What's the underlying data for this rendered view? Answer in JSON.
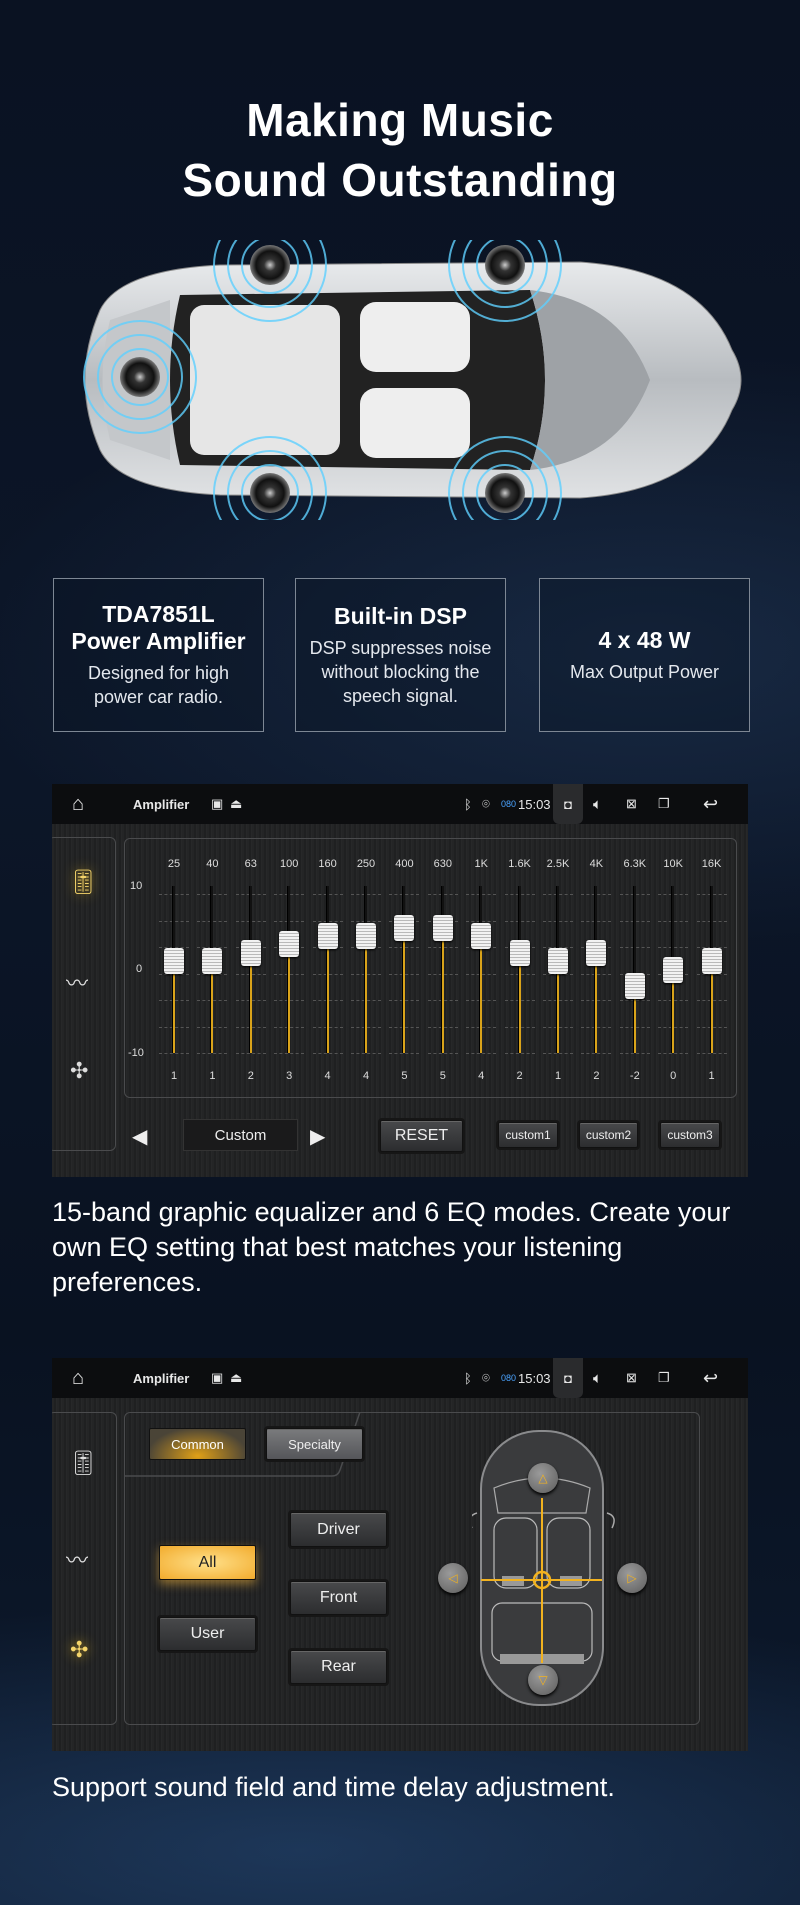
{
  "hero": {
    "title_line1": "Making Music",
    "title_line2": "Sound Outstanding"
  },
  "features": [
    {
      "heading": "TDA7851L Power Amplifier",
      "body": "Designed for high power car radio."
    },
    {
      "heading": "Built-in DSP",
      "body": "DSP suppresses noise without blocking the speech signal."
    },
    {
      "heading": "4 x 48 W",
      "body": "Max Output Power"
    }
  ],
  "status_bar": {
    "app_title": "Amplifier",
    "time": "15:03",
    "badge": "080",
    "icons": [
      "home-icon",
      "image-icon",
      "usb-icon",
      "bluetooth-icon",
      "location-icon",
      "camera-icon",
      "volume-icon",
      "close-box-icon",
      "windows-icon",
      "back-icon"
    ]
  },
  "equalizer": {
    "bands": [
      "25",
      "40",
      "63",
      "100",
      "160",
      "250",
      "400",
      "630",
      "1K",
      "1.6K",
      "2.5K",
      "4K",
      "6.3K",
      "10K",
      "16K"
    ],
    "values": [
      1,
      1,
      2,
      3,
      4,
      4,
      5,
      5,
      4,
      2,
      1,
      2,
      -2,
      0,
      1
    ],
    "range": [
      -10,
      10
    ],
    "axis_labels": [
      "10",
      "0",
      "-10"
    ],
    "preset": "Custom",
    "reset_label": "RESET",
    "custom_buttons": [
      "custom1",
      "custom2",
      "custom3"
    ],
    "accent": "#d9a31a"
  },
  "caption1": "15-band graphic equalizer and 6 EQ modes. Create your own EQ setting that best matches your listening preferences.",
  "sound_field": {
    "tabs": [
      {
        "label": "Common",
        "active": true
      },
      {
        "label": "Specialty",
        "active": false
      }
    ],
    "modes": [
      {
        "label": "All",
        "active": true
      },
      {
        "label": "User",
        "active": false
      }
    ],
    "positions": [
      "Driver",
      "Front",
      "Rear"
    ]
  },
  "caption2": "Support sound field and time delay adjustment.",
  "colors": {
    "accent_gold": "#f2ab2c",
    "background": "#0a1222"
  }
}
